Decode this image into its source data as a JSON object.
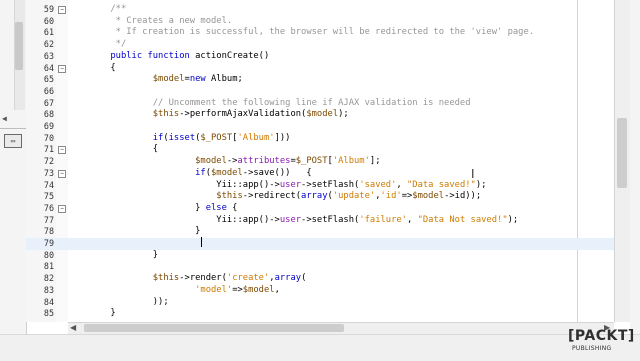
{
  "editor": {
    "lines": [
      {
        "num": "59",
        "fold": "minus",
        "segments": [
          {
            "t": "        ",
            "c": "pl"
          },
          {
            "t": "/**",
            "c": "cm"
          }
        ]
      },
      {
        "num": "60",
        "segments": [
          {
            "t": "         * Creates a new model.",
            "c": "cm"
          }
        ]
      },
      {
        "num": "61",
        "segments": [
          {
            "t": "         * If creation is successful, the browser will be redirected to the 'view' page.",
            "c": "cm"
          }
        ]
      },
      {
        "num": "62",
        "segments": [
          {
            "t": "         */",
            "c": "cm"
          }
        ]
      },
      {
        "num": "63",
        "segments": [
          {
            "t": "        ",
            "c": "pl"
          },
          {
            "t": "public function ",
            "c": "kw"
          },
          {
            "t": "actionCreate()",
            "c": "fn"
          }
        ]
      },
      {
        "num": "64",
        "fold": "minus",
        "segments": [
          {
            "t": "        {",
            "c": "pl"
          }
        ]
      },
      {
        "num": "65",
        "segments": [
          {
            "t": "                ",
            "c": "pl"
          },
          {
            "t": "$model",
            "c": "vr"
          },
          {
            "t": "=",
            "c": "pl"
          },
          {
            "t": "new ",
            "c": "kw"
          },
          {
            "t": "Album;",
            "c": "pl"
          }
        ]
      },
      {
        "num": "66",
        "segments": [
          {
            "t": "",
            "c": "pl"
          }
        ]
      },
      {
        "num": "67",
        "segments": [
          {
            "t": "                ",
            "c": "pl"
          },
          {
            "t": "// Uncomment the following line if AJAX validation is needed",
            "c": "cm"
          }
        ]
      },
      {
        "num": "68",
        "segments": [
          {
            "t": "                ",
            "c": "pl"
          },
          {
            "t": "$this",
            "c": "vr"
          },
          {
            "t": "->performAjaxValidation(",
            "c": "pl"
          },
          {
            "t": "$model",
            "c": "vr"
          },
          {
            "t": ");",
            "c": "pl"
          }
        ]
      },
      {
        "num": "69",
        "segments": [
          {
            "t": "",
            "c": "pl"
          }
        ]
      },
      {
        "num": "70",
        "segments": [
          {
            "t": "                ",
            "c": "pl"
          },
          {
            "t": "if",
            "c": "kw"
          },
          {
            "t": "(",
            "c": "pl"
          },
          {
            "t": "isset",
            "c": "kw"
          },
          {
            "t": "(",
            "c": "pl"
          },
          {
            "t": "$_POST",
            "c": "vr"
          },
          {
            "t": "[",
            "c": "pl"
          },
          {
            "t": "'Album'",
            "c": "st"
          },
          {
            "t": "]))",
            "c": "pl"
          }
        ]
      },
      {
        "num": "71",
        "fold": "minus",
        "segments": [
          {
            "t": "                {",
            "c": "pl"
          }
        ]
      },
      {
        "num": "72",
        "segments": [
          {
            "t": "                        ",
            "c": "pl"
          },
          {
            "t": "$model",
            "c": "vr"
          },
          {
            "t": "->",
            "c": "pl"
          },
          {
            "t": "attributes",
            "c": "rm"
          },
          {
            "t": "=",
            "c": "pl"
          },
          {
            "t": "$_POST",
            "c": "vr"
          },
          {
            "t": "[",
            "c": "pl"
          },
          {
            "t": "'Album'",
            "c": "st"
          },
          {
            "t": "];",
            "c": "pl"
          }
        ]
      },
      {
        "num": "73",
        "fold": "minus",
        "segments": [
          {
            "t": "                        ",
            "c": "pl"
          },
          {
            "t": "if",
            "c": "kw"
          },
          {
            "t": "(",
            "c": "pl"
          },
          {
            "t": "$model",
            "c": "vr"
          },
          {
            "t": "->save())   {",
            "c": "pl"
          }
        ]
      },
      {
        "num": "74",
        "segments": [
          {
            "t": "                            Yii::app()->",
            "c": "pl"
          },
          {
            "t": "user",
            "c": "rm"
          },
          {
            "t": "->setFlash(",
            "c": "pl"
          },
          {
            "t": "'saved'",
            "c": "st"
          },
          {
            "t": ", ",
            "c": "pl"
          },
          {
            "t": "\"Data saved!\"",
            "c": "st"
          },
          {
            "t": ");",
            "c": "pl"
          }
        ]
      },
      {
        "num": "75",
        "segments": [
          {
            "t": "                            ",
            "c": "pl"
          },
          {
            "t": "$this",
            "c": "vr"
          },
          {
            "t": "->redirect(",
            "c": "pl"
          },
          {
            "t": "array",
            "c": "kw"
          },
          {
            "t": "(",
            "c": "pl"
          },
          {
            "t": "'update'",
            "c": "st"
          },
          {
            "t": ",",
            "c": "pl"
          },
          {
            "t": "'id'",
            "c": "st"
          },
          {
            "t": "=>",
            "c": "pl"
          },
          {
            "t": "$model",
            "c": "vr"
          },
          {
            "t": "->id));",
            "c": "pl"
          }
        ]
      },
      {
        "num": "76",
        "fold": "minus",
        "segments": [
          {
            "t": "                        } ",
            "c": "pl"
          },
          {
            "t": "else",
            "c": "kw"
          },
          {
            "t": " {",
            "c": "pl"
          }
        ]
      },
      {
        "num": "77",
        "segments": [
          {
            "t": "                            Yii::app()->",
            "c": "pl"
          },
          {
            "t": "user",
            "c": "rm"
          },
          {
            "t": "->setFlash(",
            "c": "pl"
          },
          {
            "t": "'failure'",
            "c": "st"
          },
          {
            "t": ", ",
            "c": "pl"
          },
          {
            "t": "\"Data Not saved!\"",
            "c": "st"
          },
          {
            "t": ");",
            "c": "pl"
          }
        ]
      },
      {
        "num": "78",
        "segments": [
          {
            "t": "                        }",
            "c": "pl"
          }
        ]
      },
      {
        "num": "79",
        "current": true,
        "segments": [
          {
            "t": "",
            "c": "pl"
          }
        ]
      },
      {
        "num": "80",
        "segments": [
          {
            "t": "                }",
            "c": "pl"
          }
        ]
      },
      {
        "num": "81",
        "segments": [
          {
            "t": "",
            "c": "pl"
          }
        ]
      },
      {
        "num": "82",
        "segments": [
          {
            "t": "                ",
            "c": "pl"
          },
          {
            "t": "$this",
            "c": "vr"
          },
          {
            "t": "->render(",
            "c": "pl"
          },
          {
            "t": "'create'",
            "c": "st"
          },
          {
            "t": ",",
            "c": "pl"
          },
          {
            "t": "array",
            "c": "kw"
          },
          {
            "t": "(",
            "c": "pl"
          }
        ]
      },
      {
        "num": "83",
        "segments": [
          {
            "t": "                        ",
            "c": "pl"
          },
          {
            "t": "'model'",
            "c": "st"
          },
          {
            "t": "=>",
            "c": "pl"
          },
          {
            "t": "$model",
            "c": "vr"
          },
          {
            "t": ",",
            "c": "pl"
          }
        ]
      },
      {
        "num": "84",
        "segments": [
          {
            "t": "                ));",
            "c": "pl"
          }
        ]
      },
      {
        "num": "85",
        "segments": [
          {
            "t": "        }",
            "c": "pl"
          }
        ]
      }
    ]
  },
  "logo": {
    "mark": "[PACKT]",
    "sub": "PUBLISHING"
  },
  "colors": {
    "keyword": "#0000c8",
    "comment": "#969696",
    "string": "#ce7b00",
    "variable": "#7c4a00",
    "member": "#8a1bb0",
    "current_line": "#e8f0fb"
  }
}
